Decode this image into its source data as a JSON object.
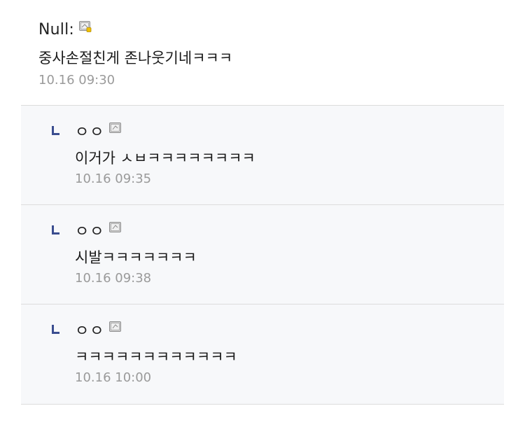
{
  "main_comment": {
    "nick": "Null:",
    "text": "중사손절친게 존나웃기네ㅋㅋㅋ",
    "date": "10.16 09:30",
    "icon": "gallog-icon-fixed"
  },
  "replies": [
    {
      "nick": "ㅇㅇ",
      "text": "이거가 ㅅㅂㅋㅋㅋㅋㅋㅋㅋㅋ",
      "date": "10.16 09:35",
      "icon": "gallog-icon"
    },
    {
      "nick": "ㅇㅇ",
      "text": "시발ㅋㅋㅋㅋㅋㅋㅋ",
      "date": "10.16 09:38",
      "icon": "gallog-icon"
    },
    {
      "nick": "ㅇㅇ",
      "text": "ㅋㅋㅋㅋㅋㅋㅋㅋㅋㅋㅋㅋ",
      "date": "10.16 10:00",
      "icon": "gallog-icon"
    }
  ],
  "colors": {
    "reply_marker": "#3a4d8f",
    "date": "#9a9a9a",
    "divider": "#dcdcdc",
    "reply_background": "#f7f8fa"
  }
}
